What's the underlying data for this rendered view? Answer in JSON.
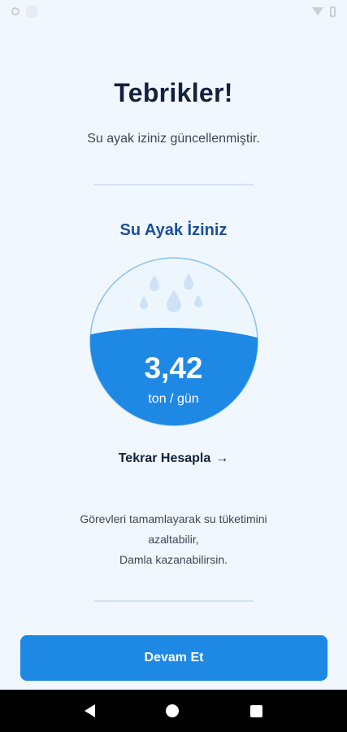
{
  "header": {
    "title": "Tebrikler!",
    "subtitle": "Su ayak iziniz güncellenmiştir."
  },
  "footprint": {
    "section_title": "Su Ayak İziniz",
    "value": "3,42",
    "unit": "ton / gün",
    "fill_level_percent": 55,
    "colors": {
      "water": "#1e88e5",
      "light": "#eef6fd",
      "outline": "#8cc3ef",
      "drops": "#cde2f4"
    }
  },
  "actions": {
    "recalculate_label": "Tekrar Hesapla",
    "recalculate_arrow": "→",
    "continue_label": "Devam Et"
  },
  "info": {
    "lines": [
      "Görevleri tamamlayarak su tüketimini",
      "azaltabilir,",
      "Damla kazanabilirsin."
    ]
  },
  "colors": {
    "background": "#f1f7fe",
    "accent": "#1e88e5",
    "section_title": "#1d4e9e"
  }
}
